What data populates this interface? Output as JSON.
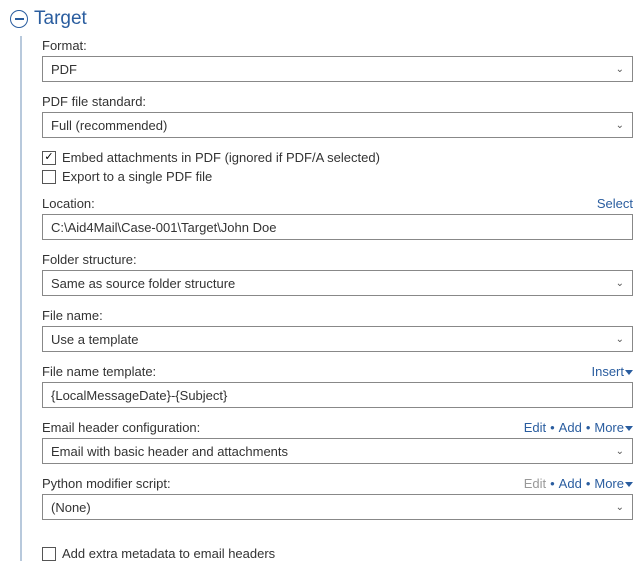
{
  "section": {
    "title": "Target"
  },
  "format": {
    "label": "Format:",
    "value": "PDF"
  },
  "pdf_standard": {
    "label": "PDF file standard:",
    "value": "Full (recommended)"
  },
  "embed_attachments": {
    "label": "Embed attachments in PDF (ignored if PDF/A selected)",
    "checked": true
  },
  "export_single": {
    "label": "Export to a single PDF file",
    "checked": false
  },
  "location": {
    "label": "Location:",
    "action": "Select",
    "value": "C:\\Aid4Mail\\Case-001\\Target\\John Doe"
  },
  "folder_structure": {
    "label": "Folder structure:",
    "value": "Same as source folder structure"
  },
  "file_name": {
    "label": "File name:",
    "value": "Use a template"
  },
  "file_name_template": {
    "label": "File name template:",
    "action": "Insert",
    "value": "{LocalMessageDate}-{Subject}"
  },
  "email_header_config": {
    "label": "Email header configuration:",
    "actions": {
      "edit": "Edit",
      "add": "Add",
      "more": "More"
    },
    "edit_enabled": true,
    "value": "Email with basic header and attachments"
  },
  "python_modifier": {
    "label": "Python modifier script:",
    "actions": {
      "edit": "Edit",
      "add": "Add",
      "more": "More"
    },
    "edit_enabled": false,
    "value": "(None)"
  },
  "add_extra_metadata": {
    "label": "Add extra metadata to email headers",
    "checked": false
  }
}
